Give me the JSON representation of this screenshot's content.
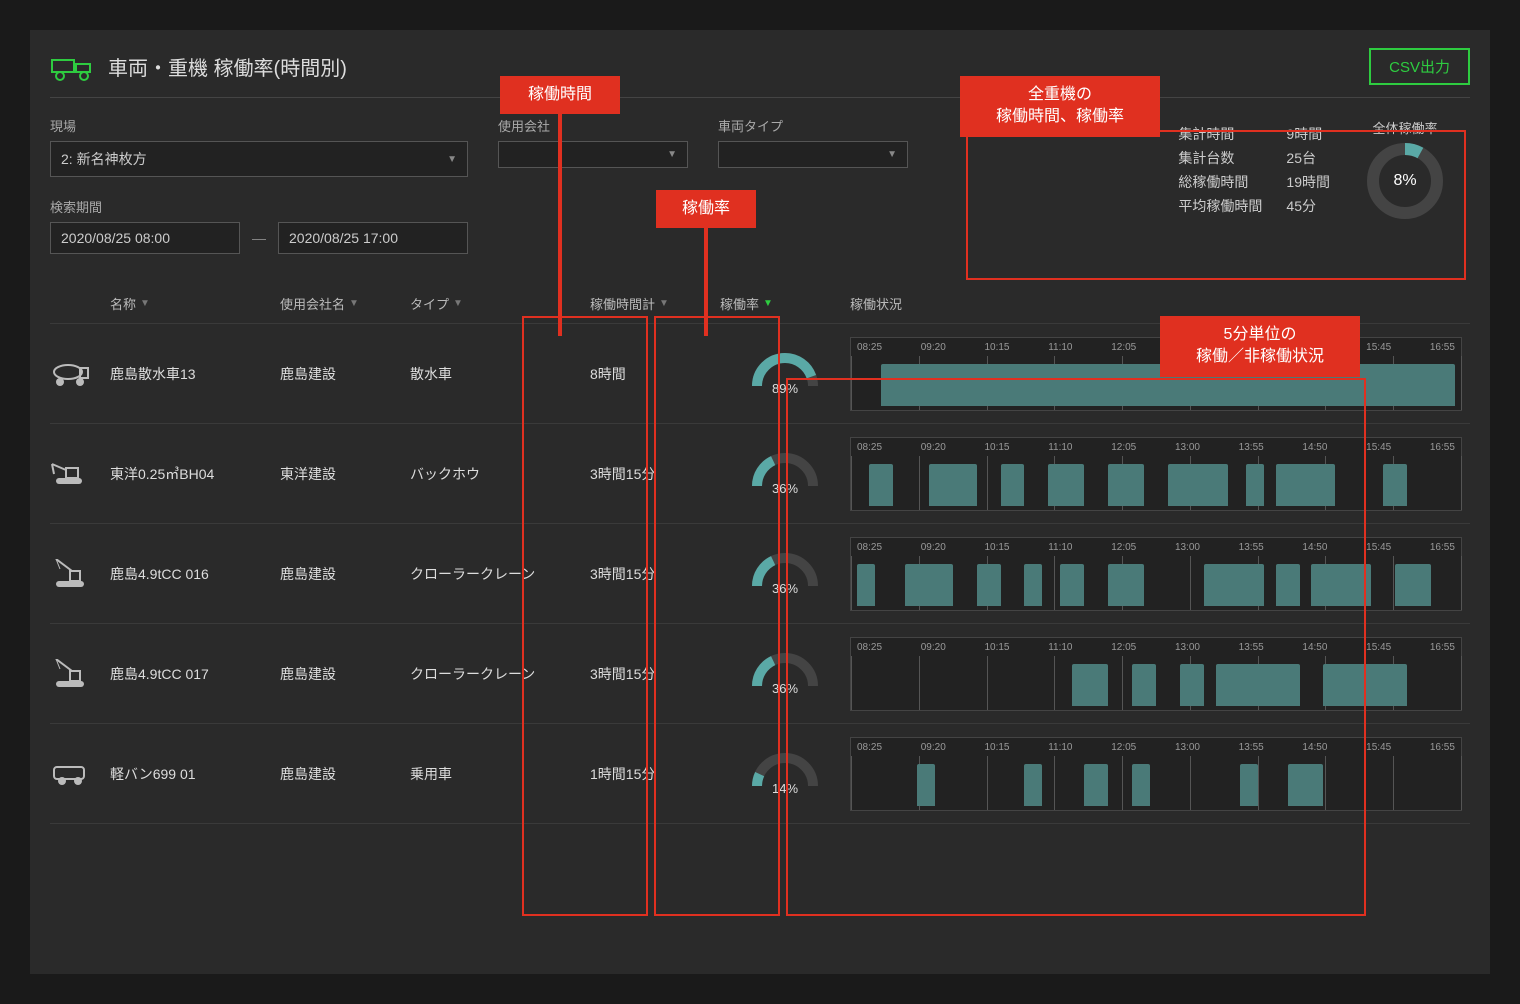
{
  "page_title": "車両・重機 稼働率(時間別)",
  "csv_button": "CSV出力",
  "filters": {
    "site_label": "現場",
    "site_value": "2: 新名神枚方",
    "company_label": "使用会社",
    "company_value": "",
    "type_label": "車両タイプ",
    "type_value": "",
    "period_label": "検索期間",
    "period_from": "2020/08/25 08:00",
    "period_to": "2020/08/25 17:00"
  },
  "summary": {
    "rows": [
      {
        "k": "集計時間",
        "v": "9時間"
      },
      {
        "k": "集計台数",
        "v": "25台"
      },
      {
        "k": "総稼働時間",
        "v": "19時間"
      },
      {
        "k": "平均稼働時間",
        "v": "45分"
      }
    ],
    "overall_label": "全体稼働率",
    "overall_pct": 8
  },
  "columns": {
    "name": "名称",
    "company": "使用会社名",
    "type": "タイプ",
    "runtime": "稼働時間計",
    "rate": "稼働率",
    "activity": "稼働状況"
  },
  "time_ticks": [
    "08:25",
    "09:20",
    "10:15",
    "11:10",
    "12:05",
    "13:00",
    "13:55",
    "14:50",
    "15:45",
    "16:55"
  ],
  "rows": [
    {
      "icon": "tanker",
      "name": "鹿島散水車13",
      "company": "鹿島建設",
      "type": "散水車",
      "runtime": "8時間",
      "rate_pct": 89,
      "bars": [
        [
          4,
          96
        ]
      ]
    },
    {
      "icon": "excavator",
      "name": "東洋0.25㎥BH04",
      "company": "東洋建設",
      "type": "バックホウ",
      "runtime": "3時間15分",
      "rate_pct": 36,
      "bars": [
        [
          2,
          4
        ],
        [
          12,
          8
        ],
        [
          24,
          4
        ],
        [
          32,
          6
        ],
        [
          42,
          6
        ],
        [
          52,
          10
        ],
        [
          65,
          3
        ],
        [
          70,
          10
        ],
        [
          88,
          4
        ]
      ]
    },
    {
      "icon": "crane",
      "name": "鹿島4.9tCC 016",
      "company": "鹿島建設",
      "type": "クローラークレーン",
      "runtime": "3時間15分",
      "rate_pct": 36,
      "bars": [
        [
          0,
          3
        ],
        [
          8,
          8
        ],
        [
          20,
          4
        ],
        [
          28,
          3
        ],
        [
          34,
          4
        ],
        [
          42,
          6
        ],
        [
          58,
          10
        ],
        [
          70,
          4
        ],
        [
          76,
          10
        ],
        [
          90,
          6
        ]
      ]
    },
    {
      "icon": "crane",
      "name": "鹿島4.9tCC 017",
      "company": "鹿島建設",
      "type": "クローラークレーン",
      "runtime": "3時間15分",
      "rate_pct": 36,
      "bars": [
        [
          36,
          6
        ],
        [
          46,
          4
        ],
        [
          54,
          4
        ],
        [
          60,
          14
        ],
        [
          78,
          14
        ]
      ]
    },
    {
      "icon": "van",
      "name": "軽バン699 01",
      "company": "鹿島建設",
      "type": "乗用車",
      "runtime": "1時間15分",
      "rate_pct": 14,
      "bars": [
        [
          10,
          3
        ],
        [
          28,
          3
        ],
        [
          38,
          4
        ],
        [
          46,
          3
        ],
        [
          64,
          3
        ],
        [
          72,
          6
        ]
      ]
    }
  ],
  "callouts": {
    "runtime": "稼働時間",
    "rate": "稼働率",
    "summary": "全重機の\n稼働時間、稼働率",
    "activity": "5分単位の\n稼働／非稼働状況"
  },
  "chart_data": {
    "type": "table",
    "title": "車両・重機 稼働率(時間別)",
    "series": [
      {
        "name": "鹿島散水車13",
        "rate_pct": 89,
        "runtime": "8時間"
      },
      {
        "name": "東洋0.25㎥BH04",
        "rate_pct": 36,
        "runtime": "3時間15分"
      },
      {
        "name": "鹿島4.9tCC 016",
        "rate_pct": 36,
        "runtime": "3時間15分"
      },
      {
        "name": "鹿島4.9tCC 017",
        "rate_pct": 36,
        "runtime": "3時間15分"
      },
      {
        "name": "軽バン699 01",
        "rate_pct": 14,
        "runtime": "1時間15分"
      }
    ],
    "overall_rate_pct": 8
  }
}
